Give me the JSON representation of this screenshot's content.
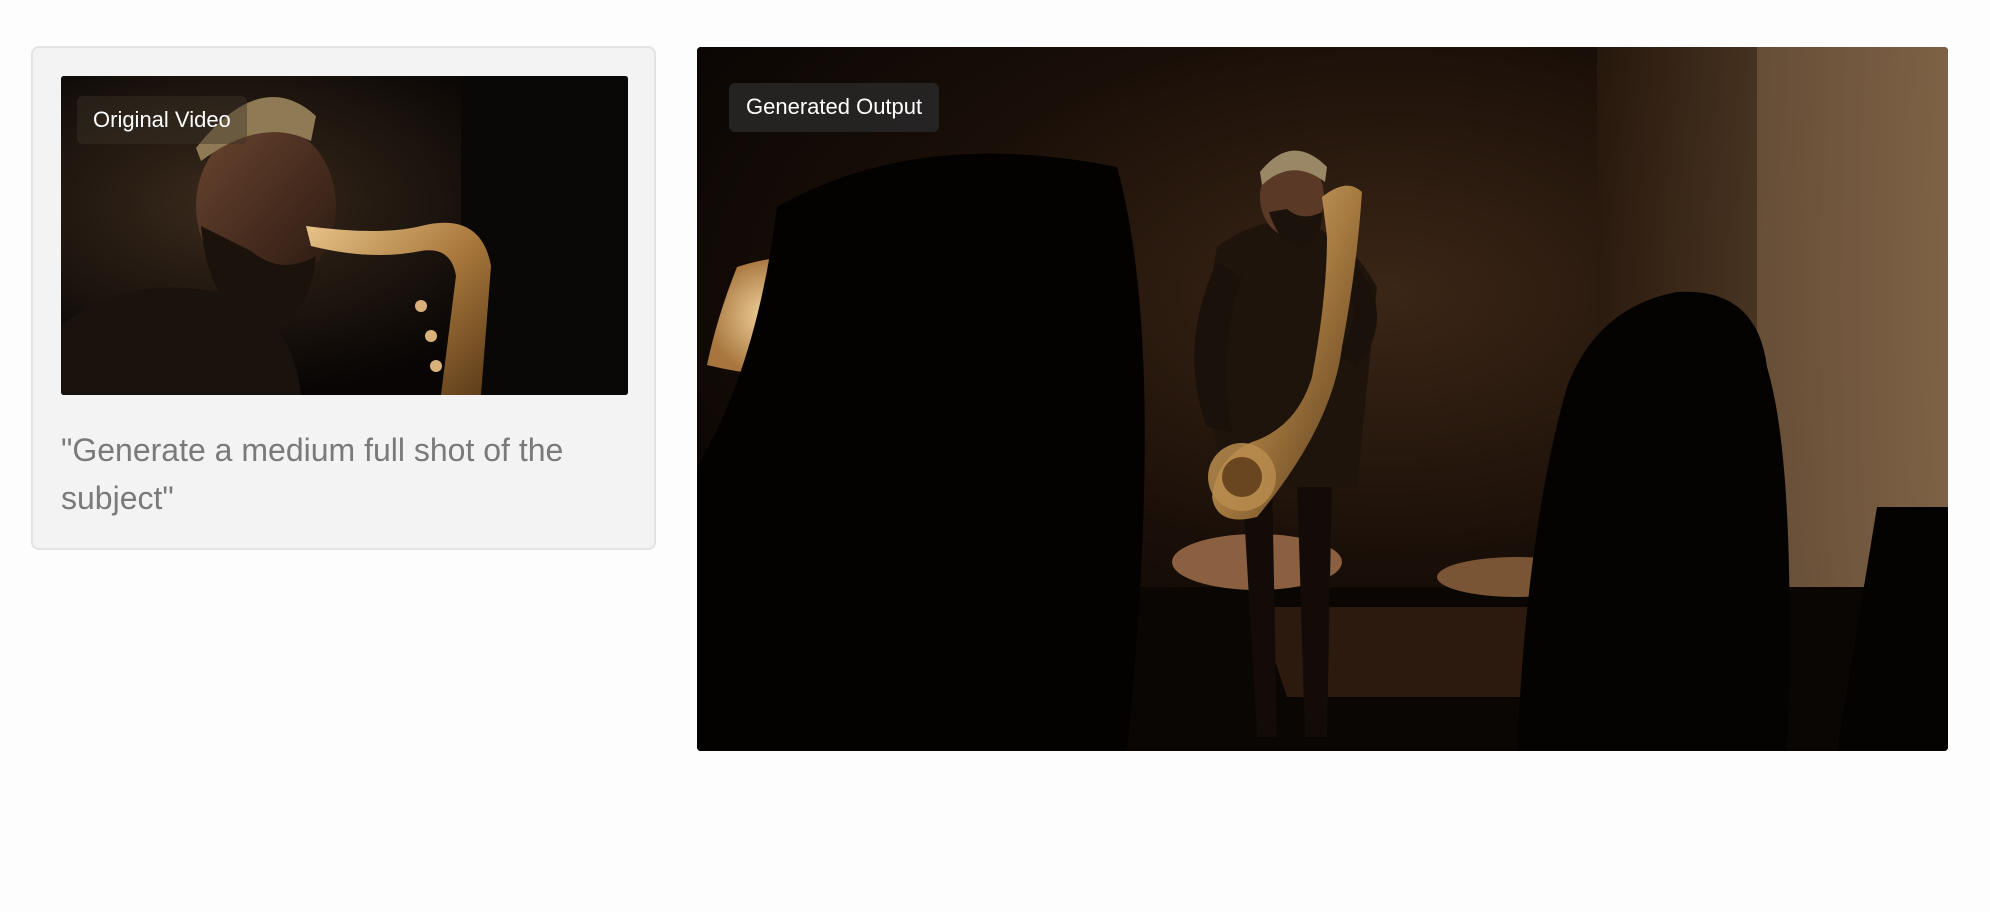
{
  "original": {
    "badge_label": "Original Video",
    "prompt_text": "\"Generate a medium full shot of the subject\""
  },
  "output": {
    "badge_label": "Generated Output"
  },
  "images": {
    "original_alt": "saxophonist-close-up",
    "output_alt": "saxophonist-medium-full-shot"
  },
  "colors": {
    "card_background": "#f3f3f3",
    "card_border": "#e3e3e3",
    "prompt_text": "#7a7a7a",
    "warm_light": "#c9924a"
  }
}
